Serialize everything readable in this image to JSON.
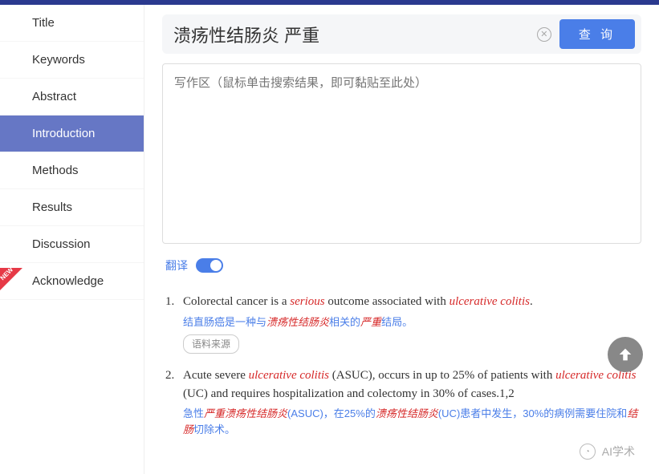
{
  "sidebar": {
    "items": [
      {
        "label": "Title"
      },
      {
        "label": "Keywords"
      },
      {
        "label": "Abstract"
      },
      {
        "label": "Introduction"
      },
      {
        "label": "Methods"
      },
      {
        "label": "Results"
      },
      {
        "label": "Discussion"
      },
      {
        "label": "Acknowledge"
      }
    ],
    "new_badge": "NEW"
  },
  "search": {
    "value": "溃疡性结肠炎 严重",
    "clear": "✕",
    "button": "查 询"
  },
  "write_area": {
    "placeholder": "写作区（鼠标单击搜索结果，即可黏贴至此处）"
  },
  "translate": {
    "label": "翻译",
    "on": true
  },
  "results": [
    {
      "num": "1.",
      "en_parts": [
        "Colorectal cancer is a ",
        "serious",
        " outcome associated with ",
        "ulcerative colitis",
        "."
      ],
      "zh_parts": [
        "结直肠癌是一种与",
        "溃疡性结肠炎",
        "相关的",
        "严重",
        "结局。"
      ],
      "source_btn": "语料来源"
    },
    {
      "num": "2.",
      "en_parts": [
        "Acute severe ",
        "ulcerative colitis",
        " (ASUC), occurs in up to 25% of patients with ",
        "ulcerative colitis",
        " (UC) and requires hospitalization and colectomy in 30% of cases.1,2"
      ],
      "zh_parts": [
        "急性",
        "严重溃疡性结肠炎",
        "(ASUC)，在25%的",
        "溃疡性结肠炎",
        "(UC)患者中发生，30%的病例需要住院和",
        "结肠",
        "切除术。"
      ]
    }
  ],
  "watermark": {
    "text": "AI学术"
  }
}
